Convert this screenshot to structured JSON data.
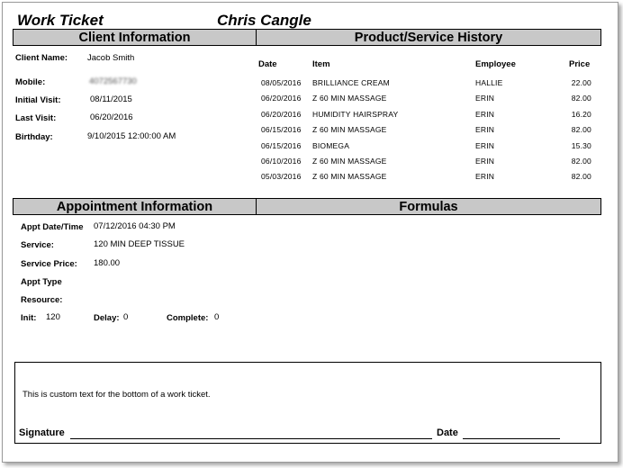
{
  "header": {
    "title": "Work Ticket",
    "customer_name": "Chris Cangle"
  },
  "client_info": {
    "section_title": "Client Information",
    "client_name_label": "Client Name:",
    "client_name": "Jacob Smith",
    "mobile_label": "Mobile:",
    "mobile": "4072567730",
    "initial_visit_label": "Initial Visit:",
    "initial_visit": "08/11/2015",
    "last_visit_label": "Last Visit:",
    "last_visit": "06/20/2016",
    "birthday_label": "Birthday:",
    "birthday": "9/10/2015 12:00:00 AM"
  },
  "history": {
    "section_title": "Product/Service History",
    "columns": {
      "date": "Date",
      "item": "Item",
      "employee": "Employee",
      "price": "Price"
    },
    "rows": [
      {
        "date": "08/05/2016",
        "item": "BRILLIANCE CREAM",
        "employee": "HALLIE",
        "price": "22.00"
      },
      {
        "date": "06/20/2016",
        "item": "Z 60 MIN MASSAGE",
        "employee": "ERIN",
        "price": "82.00"
      },
      {
        "date": "06/20/2016",
        "item": "HUMIDITY HAIRSPRAY",
        "employee": "ERIN",
        "price": "16.20"
      },
      {
        "date": "06/15/2016",
        "item": "Z 60 MIN MASSAGE",
        "employee": "ERIN",
        "price": "82.00"
      },
      {
        "date": "06/15/2016",
        "item": "BIOMEGA",
        "employee": "ERIN",
        "price": "15.30"
      },
      {
        "date": "06/10/2016",
        "item": "Z 60 MIN MASSAGE",
        "employee": "ERIN",
        "price": "82.00"
      },
      {
        "date": "05/03/2016",
        "item": "Z 60 MIN MASSAGE",
        "employee": "ERIN",
        "price": "82.00"
      }
    ]
  },
  "appointment": {
    "section_title": "Appointment Information",
    "date_label": "Appt Date/Time",
    "date": "07/12/2016 04:30 PM",
    "service_label": "Service:",
    "service": "120 MIN DEEP TISSUE",
    "price_label": "Service Price:",
    "price": "180.00",
    "type_label": "Appt Type",
    "resource_label": "Resource:",
    "init_label": "Init:",
    "init": "120",
    "delay_label": "Delay:",
    "delay": "0",
    "complete_label": "Complete:",
    "complete": "0"
  },
  "formulas": {
    "section_title": "Formulas"
  },
  "footer": {
    "custom_text": "This is custom text for the bottom of a work ticket.",
    "signature_label": "Signature",
    "date_label": "Date"
  }
}
